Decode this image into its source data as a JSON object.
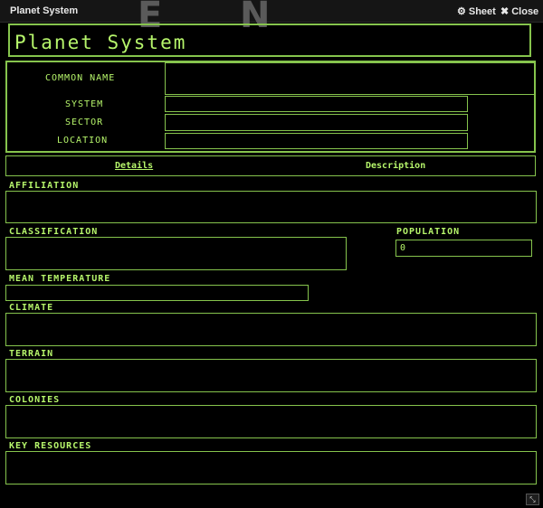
{
  "window": {
    "title": "Planet System",
    "sheet_label": "Sheet",
    "close_label": "Close",
    "bg_letters": [
      "E",
      "N"
    ]
  },
  "sheet": {
    "title": "Planet System",
    "header_fields": {
      "common_name_label": "COMMON NAME",
      "system_label": "SYSTEM",
      "sector_label": "SECTOR",
      "location_label": "LOCATION"
    },
    "tabs": [
      {
        "label": "Details",
        "active": true
      },
      {
        "label": "Description",
        "active": false
      }
    ],
    "details": {
      "affiliation_label": "AFFILIATION",
      "classification_label": "CLASSIFICATION",
      "population_label": "POPULATION",
      "population_value": "0",
      "mean_temperature_label": "MEAN TEMPERATURE",
      "climate_label": "CLIMATE",
      "terrain_label": "TERRAIN",
      "colonies_label": "COLONIES",
      "key_resources_label": "KEY RESOURCES"
    }
  },
  "colors": {
    "accent": "#b6f56b",
    "border": "#86c44d",
    "background": "#000000",
    "titlebar": "#151515"
  }
}
